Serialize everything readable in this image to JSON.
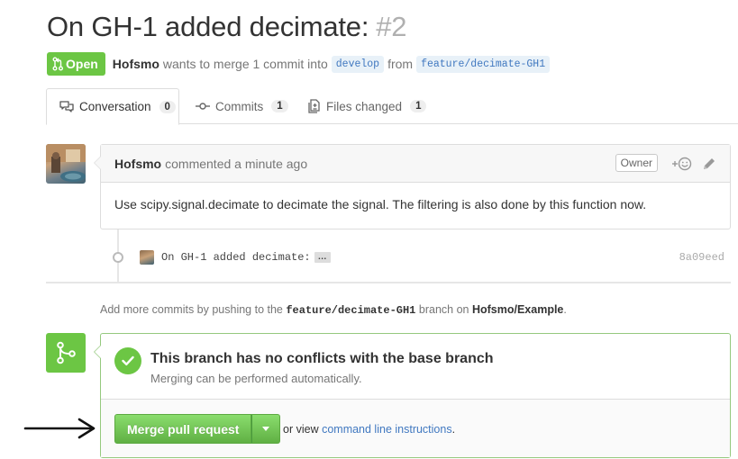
{
  "pr": {
    "title": "On GH-1 added decimate:",
    "number": "#2",
    "state": "Open",
    "author": "Hofsmo",
    "action_text": "wants to merge 1 commit into",
    "base_branch": "develop",
    "from_text": "from",
    "head_branch": "feature/decimate-GH1"
  },
  "tabs": [
    {
      "label": "Conversation",
      "count": "0",
      "icon": "comment-discussion-icon"
    },
    {
      "label": "Commits",
      "count": "1",
      "icon": "git-commit-icon"
    },
    {
      "label": "Files changed",
      "count": "1",
      "icon": "diff-icon"
    }
  ],
  "comment": {
    "author": "Hofsmo",
    "time_text": "commented a minute ago",
    "badge": "Owner",
    "body": "Use scipy.signal.decimate to decimate the signal. The filtering is also done by this function now."
  },
  "commit": {
    "message": "On GH-1 added decimate:",
    "ellipsis": "…",
    "sha": "8a09eed"
  },
  "push_hint": {
    "prefix": "Add more commits by pushing to the",
    "branch": "feature/decimate-GH1",
    "middle": "branch on",
    "repo": "Hofsmo/Example",
    "suffix": "."
  },
  "merge": {
    "status_title": "This branch has no conflicts with the base branch",
    "status_sub": "Merging can be performed automatically.",
    "button_label": "Merge pull request",
    "or_view": "or view",
    "link": "command line instructions",
    "link_suffix": "."
  },
  "colors": {
    "open_green": "#6cc644",
    "link_blue": "#4078c0",
    "muted": "#767676"
  }
}
